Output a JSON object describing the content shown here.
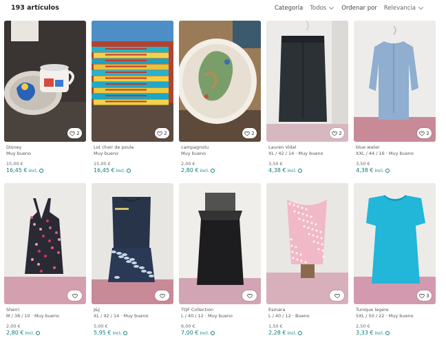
{
  "header": {
    "count": "193 artículos",
    "category_label": "Categoría",
    "category_value": "Todos",
    "sort_label": "Ordenar por",
    "sort_value": "Relevancia"
  },
  "colors": {
    "accent": "#0b7c7c"
  },
  "items": [
    {
      "title": "Disney",
      "details": "Muy bueno",
      "price": "15,00 €",
      "price_incl": "16,45 €",
      "incl": "incl.",
      "likes": "2",
      "image": "disney-mug"
    },
    {
      "title": "Lot chair de poule",
      "details": "Muy bueno",
      "price": "15,00 €",
      "price_incl": "16,45 €",
      "incl": "incl.",
      "likes": "2",
      "image": "books"
    },
    {
      "title": "campagnolu",
      "details": "Muy bueno",
      "price": "2,00 €",
      "price_incl": "2,80 €",
      "incl": "incl.",
      "likes": "2",
      "image": "plate"
    },
    {
      "title": "Lauren Vidal",
      "details": "XL / 42 / 14 · Muy bueno",
      "price": "3,50 €",
      "price_incl": "4,38 €",
      "incl": "incl.",
      "likes": "2",
      "image": "dark-skirt"
    },
    {
      "title": "blue water",
      "details": "XXL / 44 / 16 · Muy bueno",
      "price": "3,50 €",
      "price_incl": "4,38 €",
      "incl": "incl.",
      "likes": "2",
      "image": "blue-shirt"
    },
    {
      "title": "Sherri",
      "details": "M / 38 / 10 · Muy bueno",
      "price": "2,00 €",
      "price_incl": "2,80 €",
      "incl": "incl.",
      "likes": "",
      "image": "floral-dress"
    },
    {
      "title": "J&J",
      "details": "XL / 42 / 14 · Muy bueno",
      "price": "5,00 €",
      "price_incl": "5,95 €",
      "incl": "incl.",
      "likes": "",
      "image": "navy-dress"
    },
    {
      "title": "TQF Collection",
      "details": "L / 40 / 12 · Muy bueno",
      "price": "6,00 €",
      "price_incl": "7,00 €",
      "incl": "incl.",
      "likes": "",
      "image": "black-dress"
    },
    {
      "title": "Esmara",
      "details": "L / 40 / 12 · Bueno",
      "price": "1,50 €",
      "price_incl": "2,28 €",
      "incl": "incl.",
      "likes": "",
      "image": "pink-top"
    },
    {
      "title": "Tunique legere",
      "details": "5XL / 50 / 22 · Muy bueno",
      "price": "2,50 €",
      "price_incl": "3,33 €",
      "incl": "incl.",
      "likes": "3",
      "image": "turquoise-tunic"
    }
  ]
}
